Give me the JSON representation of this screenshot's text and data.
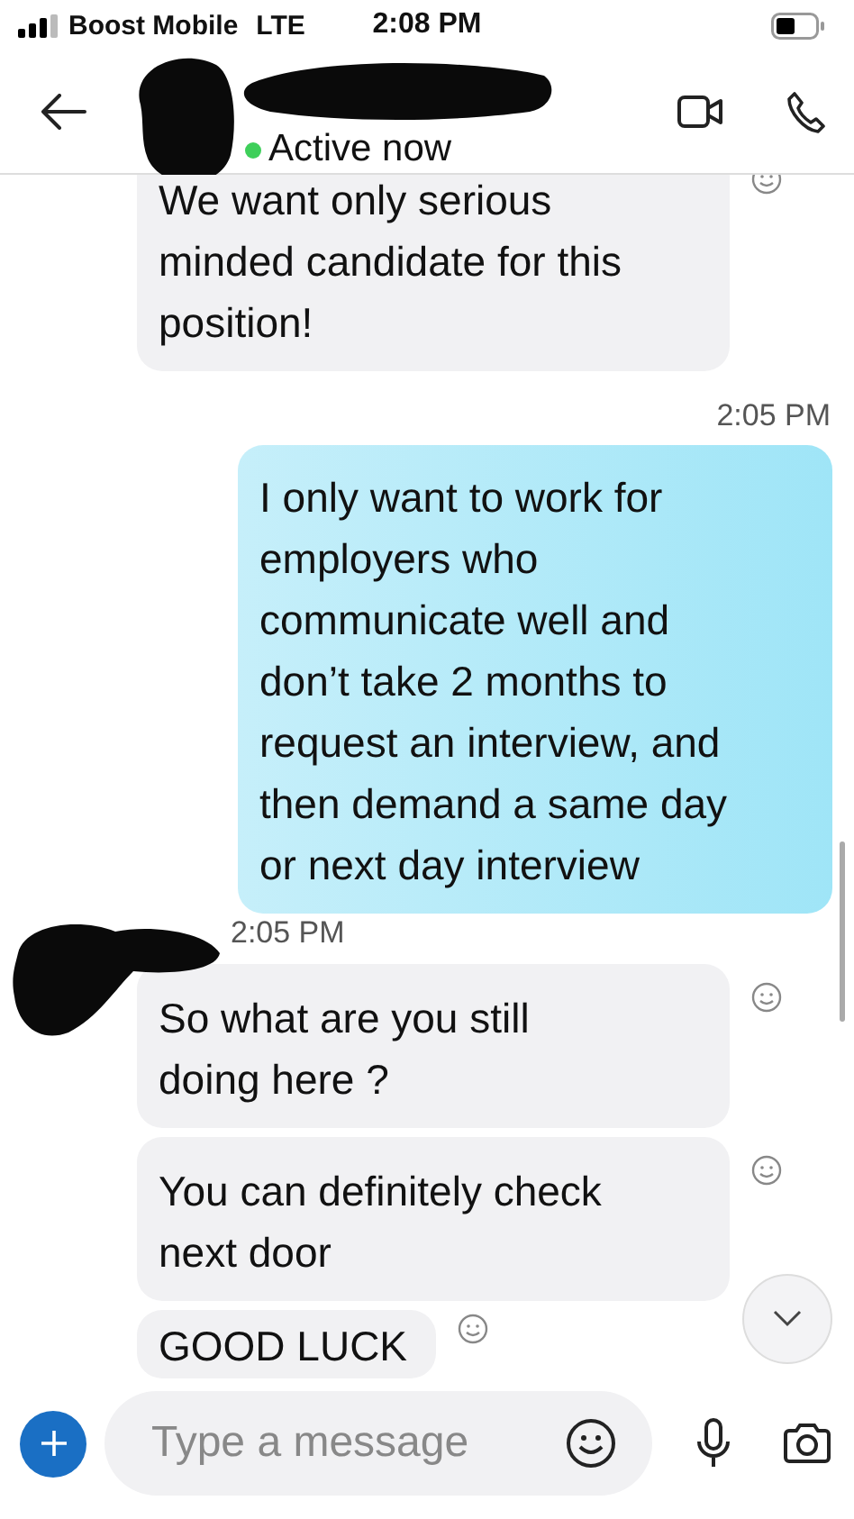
{
  "status_bar": {
    "carrier": "Boost Mobile",
    "network": "LTE",
    "time": "2:08 PM"
  },
  "header": {
    "presence": "Active now",
    "online": true
  },
  "messages": [
    {
      "kind": "incoming",
      "lines": [
        "We want only serious",
        "minded candidate for this",
        "position!"
      ]
    },
    {
      "kind": "time",
      "text": "2:05 PM"
    },
    {
      "kind": "outgoing",
      "lines": [
        "I only want to work for",
        "employers who",
        "communicate well and",
        "don’t take 2 months to",
        "request an interview, and",
        "then demand a same day",
        "or next day interview"
      ]
    },
    {
      "kind": "sender_time",
      "text": "2:05 PM"
    },
    {
      "kind": "incoming",
      "lines": [
        "So what are you still",
        "doing here ?"
      ]
    },
    {
      "kind": "incoming",
      "lines": [
        "You can definitely check",
        "next door"
      ]
    },
    {
      "kind": "incoming_short",
      "lines": [
        "GOOD LUCK"
      ]
    }
  ],
  "composer": {
    "placeholder": "Type a message"
  }
}
